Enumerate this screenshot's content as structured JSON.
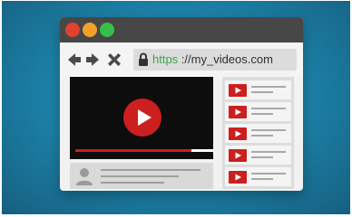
{
  "browser": {
    "window_buttons": [
      "close",
      "minimize",
      "maximize"
    ],
    "address": {
      "scheme": "https",
      "rest": " ://my_videos.com"
    },
    "nav_icons": [
      "back-arrow-icon",
      "forward-arrow-icon",
      "close-x-icon"
    ]
  },
  "player": {
    "progress": 0.84
  },
  "related_videos": {
    "count": 5
  },
  "colors": {
    "background": "#1c7ea4",
    "titlebar": "#474747",
    "dot_red": "#e0432e",
    "dot_orange": "#f1a12a",
    "dot_green": "#36c049",
    "accent_red": "#cc1f1f",
    "url_green": "#3fa34d"
  }
}
